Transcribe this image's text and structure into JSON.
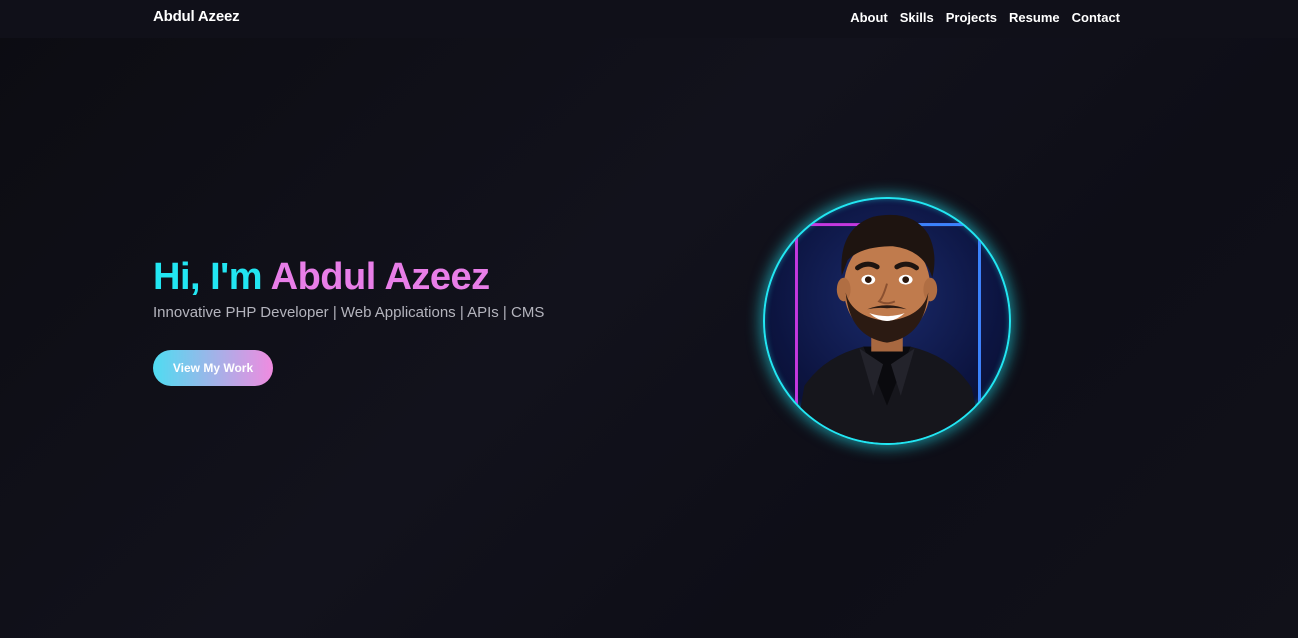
{
  "nav": {
    "brand": "Abdul Azeez",
    "links": [
      "About",
      "Skills",
      "Projects",
      "Resume",
      "Contact"
    ]
  },
  "hero": {
    "greeting": "Hi, I'm",
    "name": "Abdul Azeez",
    "tagline": "Innovative PHP Developer | Web Applications | APIs | CMS",
    "cta_label": "View My Work"
  },
  "colors": {
    "background": "#0d0d14",
    "accent_cyan": "#22e6f2",
    "accent_pink": "#e87ee8"
  },
  "avatar": {
    "icon": "profile-avatar-illustration"
  }
}
